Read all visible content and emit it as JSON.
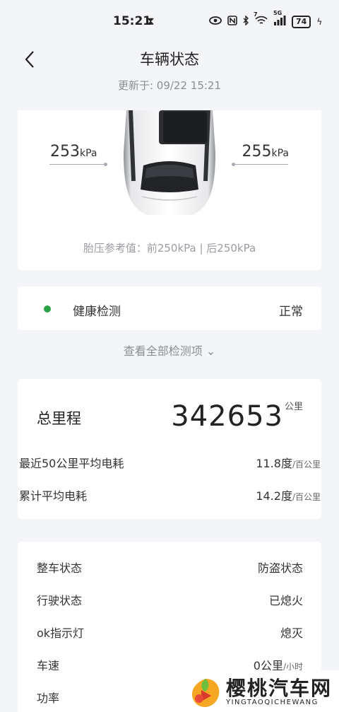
{
  "status_bar": {
    "time": "15:21",
    "signal": "5G",
    "battery": "74",
    "signal_badge": "7"
  },
  "nav": {
    "title": "车辆状态",
    "updated": "更新于: 09/22 15:21"
  },
  "tire": {
    "left_value": "253",
    "right_value": "255",
    "unit": "kPa",
    "reference": "胎压参考值：前250kPa | 后250kPa"
  },
  "health": {
    "label": "健康检测",
    "value": "正常",
    "status_color": "#2aa146",
    "view_all": "查看全部检测项 ⌄"
  },
  "mileage": {
    "total_label": "总里程",
    "total_value": "342653",
    "total_unit": "公里",
    "recent_label": "最近50公里平均电耗",
    "recent_value": "11.8度",
    "recent_unit": "/百公里",
    "avg_label": "累计平均电耗",
    "avg_value": "14.2度",
    "avg_unit": "/百公里"
  },
  "vehicle_status": {
    "rows": [
      {
        "label": "整车状态",
        "value": "防盗状态",
        "unit": ""
      },
      {
        "label": "行驶状态",
        "value": "已熄火",
        "unit": ""
      },
      {
        "label": "ok指示灯",
        "value": "熄灭",
        "unit": ""
      },
      {
        "label": "车速",
        "value": "0公里",
        "unit": "/小时"
      },
      {
        "label": "功率",
        "value": "",
        "unit": ""
      }
    ]
  },
  "watermark": {
    "title": "樱桃汽车网",
    "subtitle": "YINGTAOQICHEWANG"
  }
}
